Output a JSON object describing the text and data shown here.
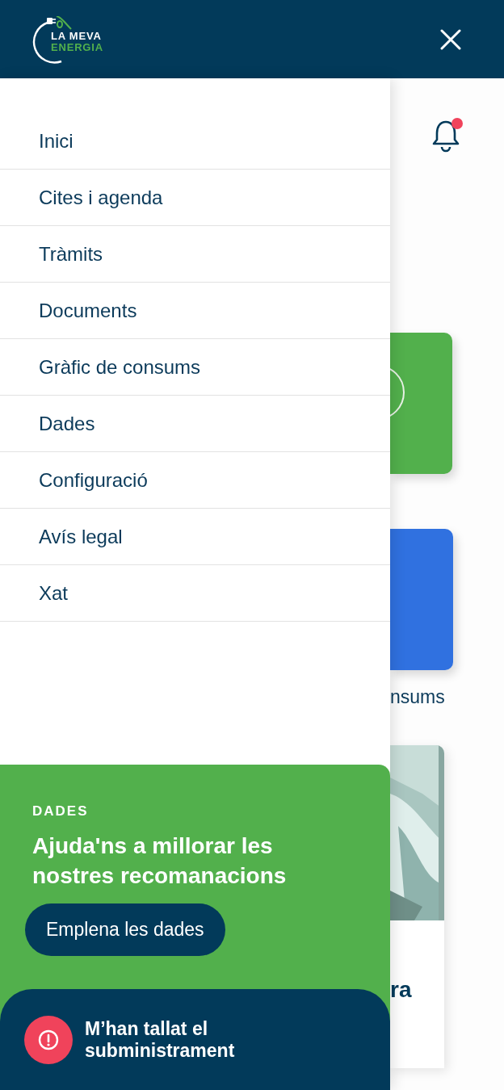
{
  "header": {
    "logo_line_1": "LA MEVA",
    "logo_line_2": "ENERGIA"
  },
  "notifications": {
    "unread": true
  },
  "background": {
    "tile_1_caption": "nsums",
    "article_title": "ra"
  },
  "menu": {
    "items": [
      {
        "label": "Inici"
      },
      {
        "label": "Cites i agenda"
      },
      {
        "label": "Tràmits"
      },
      {
        "label": "Documents"
      },
      {
        "label": "Gràfic de consums"
      },
      {
        "label": "Dades"
      },
      {
        "label": "Configuració"
      },
      {
        "label": "Avís legal"
      },
      {
        "label": "Xat"
      }
    ]
  },
  "data_card": {
    "label": "DADES",
    "title": "Ajuda'ns a millorar les nostres recomanacions",
    "button": "Emplena les dades"
  },
  "alert": {
    "text": "M’han tallat el subministrament"
  }
}
